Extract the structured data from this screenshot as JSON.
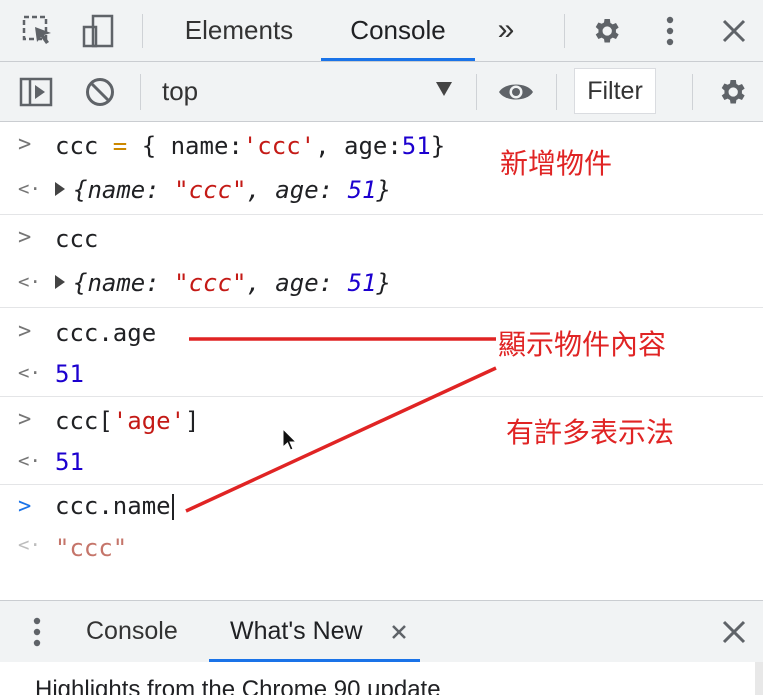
{
  "devtools": {
    "tabs": [
      {
        "label": "Elements",
        "active": false
      },
      {
        "label": "Console",
        "active": true
      }
    ],
    "more_tabs_label": "»"
  },
  "console_toolbar": {
    "context": "top",
    "filter_label": "Filter"
  },
  "console": {
    "entries": [
      {
        "type": "input",
        "code": "ccc = { name:'ccc', age:51}"
      },
      {
        "type": "output",
        "text": "{name: \"ccc\", age: 51}"
      },
      {
        "type": "input",
        "code": "ccc"
      },
      {
        "type": "output",
        "text": "{name: \"ccc\", age: 51}"
      },
      {
        "type": "input",
        "code": "ccc.age"
      },
      {
        "type": "output",
        "text": "51"
      },
      {
        "type": "input",
        "code": "ccc['age']"
      },
      {
        "type": "output",
        "text": "51"
      },
      {
        "type": "current_input",
        "code": "ccc.name"
      },
      {
        "type": "eager_result",
        "text": "\"ccc\""
      }
    ]
  },
  "annotations": {
    "add_object": "新增物件",
    "show_content": "顯示物件內容",
    "many_notations": "有許多表示法",
    "color": "#e02424"
  },
  "drawer": {
    "tabs": [
      {
        "label": "Console",
        "active": false
      },
      {
        "label": "What's New",
        "active": true
      }
    ],
    "whats_new_heading": "Highlights from the Chrome 90 update"
  },
  "colors": {
    "accent": "#1a73e8",
    "string": "#c41a16",
    "number": "#1c00cf",
    "toolbar_bg": "#f1f3f4"
  }
}
